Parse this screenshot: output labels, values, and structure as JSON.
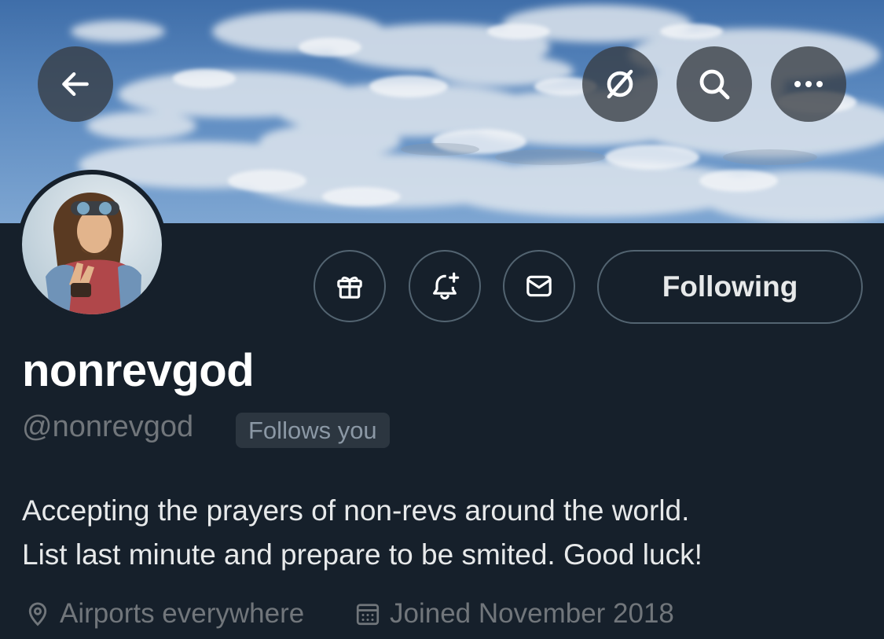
{
  "nav": {
    "back_icon": "arrow-left-icon",
    "grok_icon": "slash-circle-icon",
    "search_icon": "search-icon",
    "more_icon": "more-horizontal-icon"
  },
  "profile": {
    "display_name": "nonrevgod",
    "handle": "@nonrevgod",
    "follows_you": "Follows you",
    "bio_lines": [
      "Accepting the prayers of non-revs around the world.",
      "List last minute and prepare to be smited. Good luck!"
    ],
    "location": "Airports everywhere",
    "joined": "Joined November 2018"
  },
  "actions": {
    "gift_icon": "gift-icon",
    "notify_icon": "bell-plus-icon",
    "message_icon": "envelope-icon",
    "following_label": "Following"
  },
  "colors": {
    "background": "#16202b",
    "muted_text": "#71767b",
    "primary_text": "#e7e9ea",
    "border": "#536471"
  }
}
